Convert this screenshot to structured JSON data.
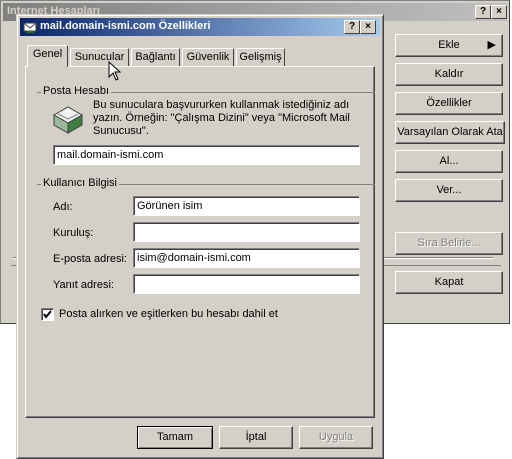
{
  "background_window": {
    "title": "Internet Hesapları",
    "buttons": {
      "add": "Ekle",
      "remove": "Kaldır",
      "properties": "Özellikler",
      "set_default": "Varsayılan Olarak Ata",
      "import": "Al...",
      "export": "Ver...",
      "set_order": "Sıra Belirle...",
      "close": "Kapat"
    }
  },
  "dialog": {
    "title": "mail.domain-ismi.com Özellikleri",
    "help_glyph": "?",
    "close_glyph": "×",
    "tabs": [
      {
        "label": "Genel"
      },
      {
        "label": "Sunucular"
      },
      {
        "label": "Bağlantı"
      },
      {
        "label": "Güvenlik"
      },
      {
        "label": "Gelişmiş"
      }
    ],
    "mail_account": {
      "group_label": "Posta Hesabı",
      "description": "Bu sunuculara başvururken kullanmak istediğiniz adı yazın.  Örneğin: \"Çalışma Dizini\" veya \"Microsoft Mail Sunucusu\".",
      "account_name": "mail.domain-ismi.com"
    },
    "user_info": {
      "group_label": "Kullanıcı Bilgisi",
      "name_label": "Adı:",
      "name_value": "Görünen isim",
      "org_label": "Kuruluş:",
      "org_value": "",
      "email_label": "E-posta adresi:",
      "email_value": "isim@domain-ismi.com",
      "reply_label": "Yanıt adresi:",
      "reply_value": ""
    },
    "include_checkbox": {
      "label": "Posta alırken ve eşitlerken bu hesabı dahil et",
      "checked": true
    },
    "buttons": {
      "ok": "Tamam",
      "cancel": "İptal",
      "apply": "Uygula"
    }
  }
}
